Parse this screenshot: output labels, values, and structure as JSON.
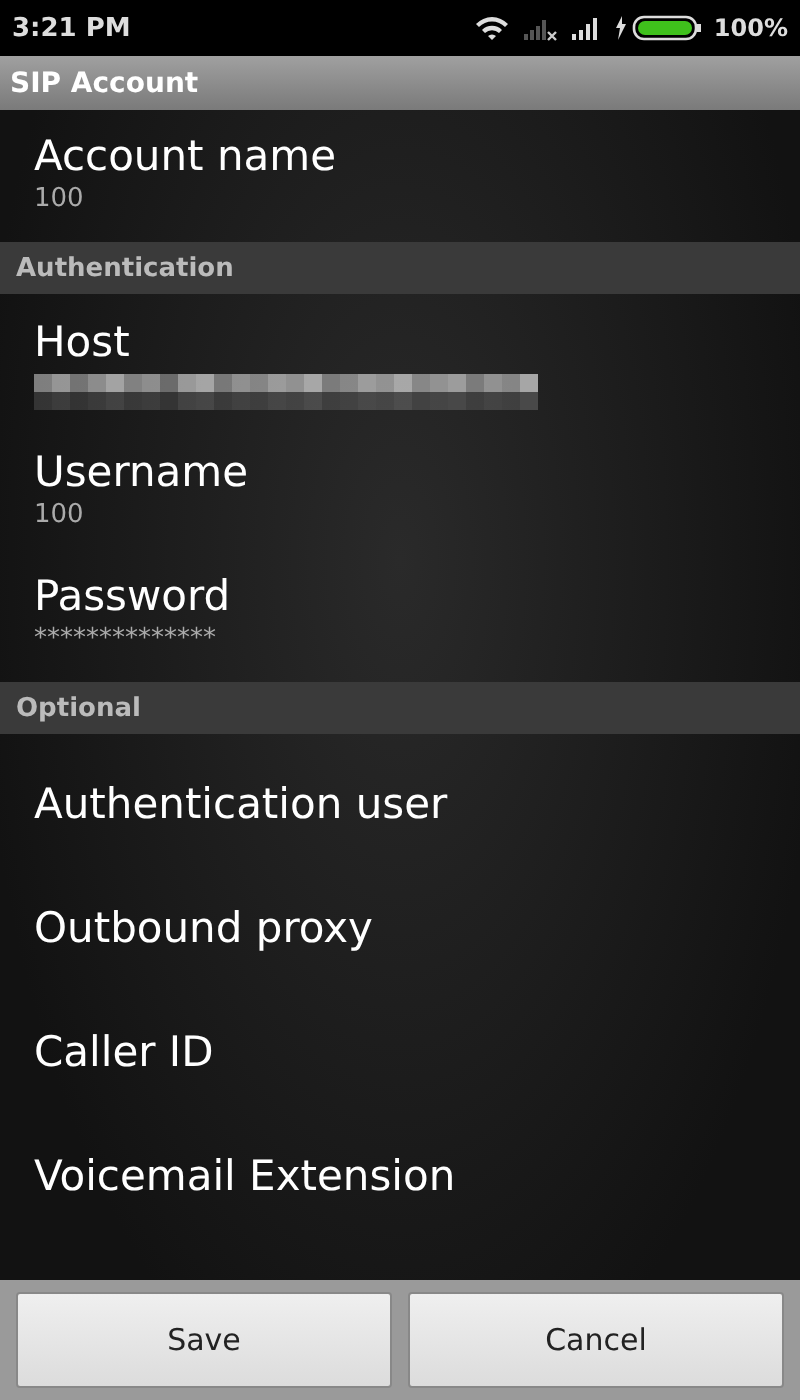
{
  "status_bar": {
    "time": "3:21 PM",
    "battery": "100%"
  },
  "title": "SIP Account",
  "rows": [
    {
      "kind": "item",
      "title": "Account name",
      "summary": "100"
    },
    {
      "kind": "header",
      "title": "Authentication"
    },
    {
      "kind": "redacted_item",
      "title": "Host"
    },
    {
      "kind": "item",
      "title": "Username",
      "summary": "100"
    },
    {
      "kind": "item",
      "title": "Password",
      "summary": "**************"
    },
    {
      "kind": "header",
      "title": "Optional"
    },
    {
      "kind": "item",
      "title": "Authentication user"
    },
    {
      "kind": "item",
      "title": "Outbound proxy"
    },
    {
      "kind": "item",
      "title": "Caller ID"
    },
    {
      "kind": "item",
      "title": "Voicemail Extension"
    }
  ],
  "buttons": [
    "Save",
    "Cancel"
  ]
}
